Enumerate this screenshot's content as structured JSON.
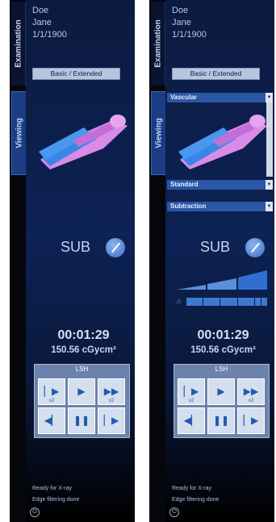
{
  "panels": [
    {
      "tabs": {
        "examination": "Examination",
        "viewing": "Viewing"
      },
      "patient": {
        "last_name": "Doe",
        "first_name": "Jane",
        "dob": "1/1/1900"
      },
      "mode_button": "Basic / Extended",
      "sub_label": "SUB",
      "time": "00:01:29",
      "dose": "150.56 cGycm²",
      "controls": {
        "title": "LSH",
        "top_left_sub": "x2",
        "top_right_sub": "x2"
      },
      "status": [
        "Ready for X-ray",
        "Edge filtering done"
      ]
    },
    {
      "tabs": {
        "examination": "Examination",
        "viewing": "Viewing"
      },
      "patient": {
        "last_name": "Doe",
        "first_name": "Jane",
        "dob": "1/1/1900"
      },
      "mode_button": "Basic / Extended",
      "dropdowns": {
        "protocol": "Vascular",
        "program": "Standard",
        "processing": "Subtraction"
      },
      "sub_label": "SUB",
      "time": "00:01:29",
      "dose": "150.56 cGycm²",
      "controls": {
        "title": "LSH",
        "top_left_sub": "x2",
        "top_right_sub": "x2"
      },
      "status": [
        "Ready for X-ray",
        "Edge filtering done"
      ]
    }
  ]
}
